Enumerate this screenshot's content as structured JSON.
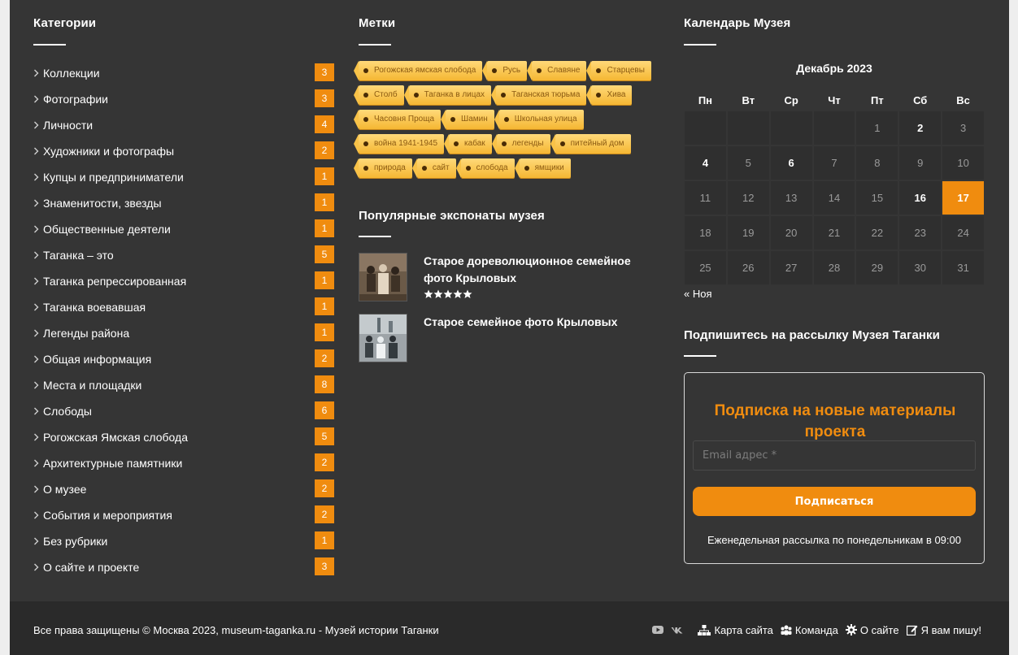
{
  "colors": {
    "accent": "#f08c0f",
    "background": "#353535",
    "footer": "#2a2a2a",
    "tag": "#f5b733"
  },
  "categories": {
    "title": "Категории",
    "items": [
      {
        "label": "Коллекции",
        "count": "3"
      },
      {
        "label": "Фотографии",
        "count": "3"
      },
      {
        "label": "Личности",
        "count": "4"
      },
      {
        "label": "Художники и фотографы",
        "count": "2"
      },
      {
        "label": "Купцы и предприниматели",
        "count": "1"
      },
      {
        "label": "Знаменитости, звезды",
        "count": "1"
      },
      {
        "label": "Общественные деятели",
        "count": "1"
      },
      {
        "label": "Таганка – это",
        "count": "5"
      },
      {
        "label": "Таганка репрессированная",
        "count": "1"
      },
      {
        "label": "Таганка воевавшая",
        "count": "1"
      },
      {
        "label": "Легенды района",
        "count": "1"
      },
      {
        "label": "Общая информация",
        "count": "2"
      },
      {
        "label": "Места и площадки",
        "count": "8"
      },
      {
        "label": "Слободы",
        "count": "6"
      },
      {
        "label": "Рогожская Ямская слобода",
        "count": "5"
      },
      {
        "label": "Архитектурные памятники",
        "count": "2"
      },
      {
        "label": "О музее",
        "count": "2"
      },
      {
        "label": "События и мероприятия",
        "count": "2"
      },
      {
        "label": "Без рубрики",
        "count": "1"
      },
      {
        "label": "О сайте и проекте",
        "count": "3"
      }
    ]
  },
  "tags": {
    "title": "Метки",
    "rows": [
      [
        "Рогожская ямская слобода",
        "Русь",
        "Славяне",
        "Старцевы"
      ],
      [
        "Столб",
        "Таганка в лицах",
        "Таганская тюрьма",
        "Хива"
      ],
      [
        "Часовня Проща",
        "Шамин",
        "Школьная улица"
      ],
      [
        "война 1941-1945",
        "кабак",
        "легенды",
        "питейный дом"
      ],
      [
        "природа",
        "сайт",
        "слобода",
        "ямщики"
      ]
    ]
  },
  "popular": {
    "title": "Популярные экспонаты музея",
    "items": [
      {
        "title": "Старое дореволюционное семейное фото Крыловых",
        "rating": 5,
        "thumb_icon": "family-photo"
      },
      {
        "title": "Старое семейное фото Крыловых",
        "thumb_icon": "family-photo"
      }
    ]
  },
  "calendar": {
    "title": "Календарь Музея",
    "caption": "Декабрь 2023",
    "weekdays": [
      "Пн",
      "Вт",
      "Ср",
      "Чт",
      "Пт",
      "Сб",
      "Вс"
    ],
    "weeks": [
      [
        "",
        "",
        "",
        "",
        "1",
        "2",
        "3"
      ],
      [
        "4",
        "5",
        "6",
        "7",
        "8",
        "9",
        "10"
      ],
      [
        "11",
        "12",
        "13",
        "14",
        "15",
        "16",
        "17"
      ],
      [
        "18",
        "19",
        "20",
        "21",
        "22",
        "23",
        "24"
      ],
      [
        "25",
        "26",
        "27",
        "28",
        "29",
        "30",
        "31"
      ]
    ],
    "linked_days": [
      "2",
      "4",
      "6",
      "16"
    ],
    "today": "17",
    "prev_label": "« Ноя"
  },
  "subscribe": {
    "title": "Подпишитесь на рассылку Музея Таганки",
    "heading": "Подписка на новые материалы проекта",
    "email_placeholder": "Email адрес *",
    "button_label": "Подписаться",
    "note": "Еженедельная рассылка по понедельникам в 09:00"
  },
  "footer": {
    "copyright": "Все права защищены © Москва 2023, museum-taganka.ru - Музей истории Таганки",
    "social": [
      "youtube-icon",
      "vk-icon"
    ],
    "links": [
      {
        "label": "Карта сайта",
        "icon": "sitemap-icon"
      },
      {
        "label": "Команда",
        "icon": "team-icon"
      },
      {
        "label": "О сайте",
        "icon": "gear-icon"
      },
      {
        "label": "Я вам пишу!",
        "icon": "edit-icon"
      }
    ]
  }
}
